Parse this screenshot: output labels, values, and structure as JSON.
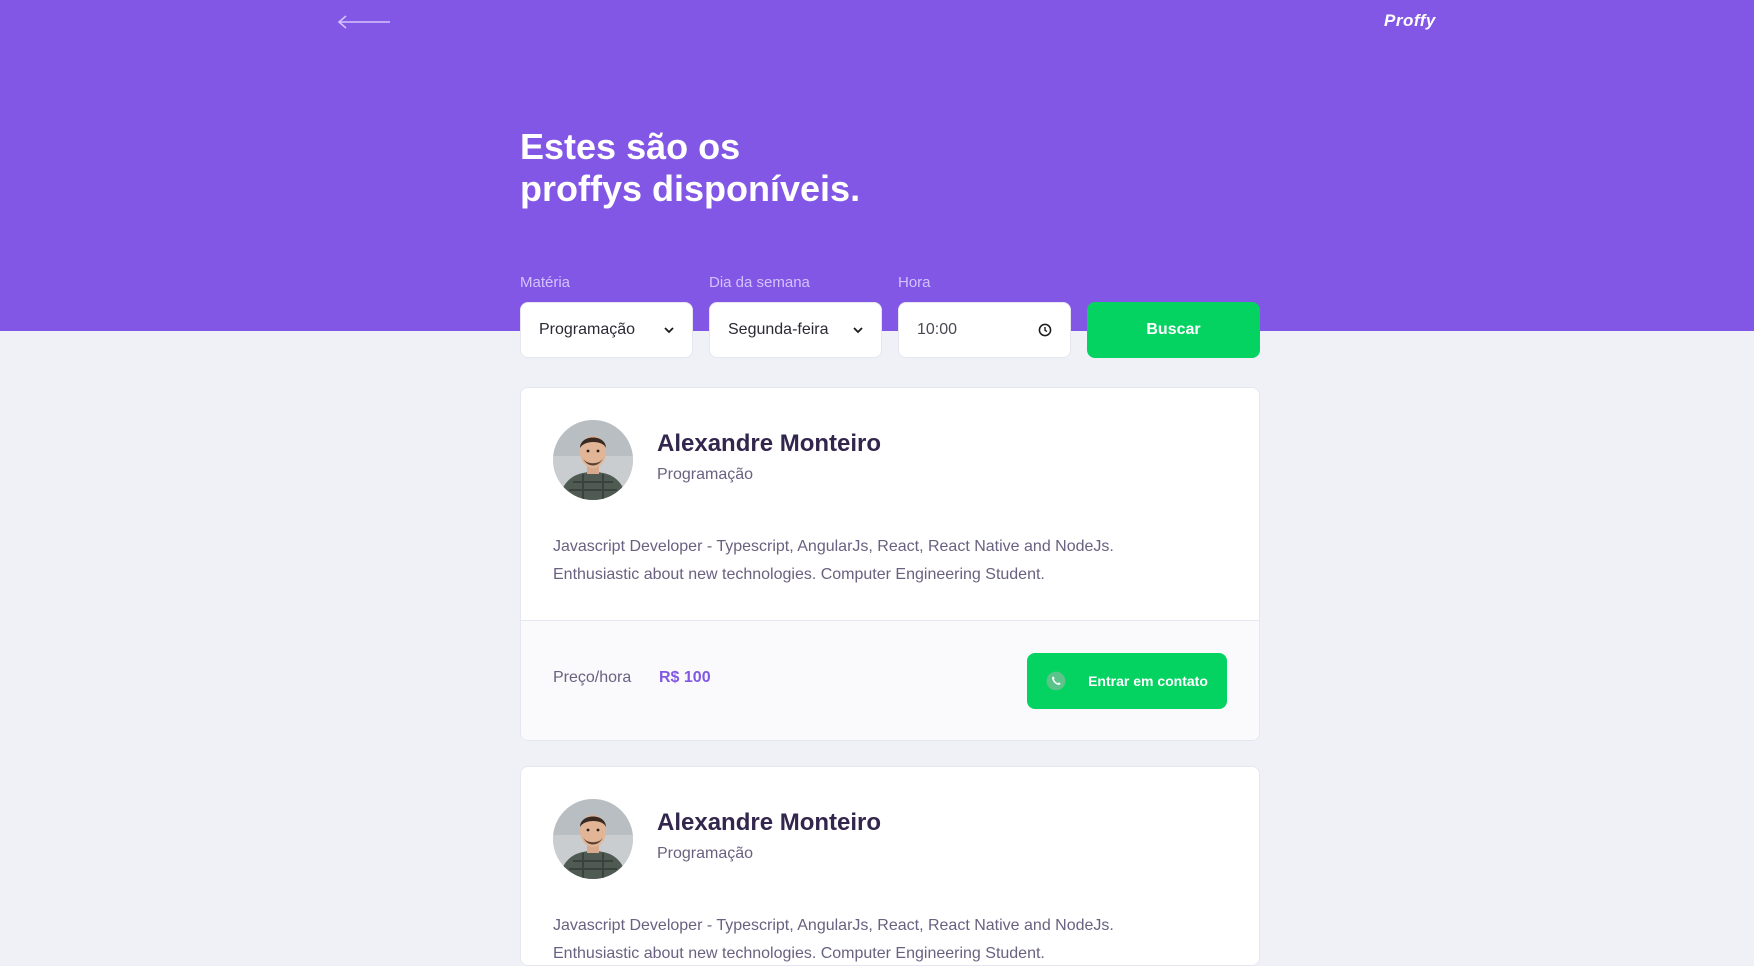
{
  "app": {
    "logo": "Proffy",
    "title_line1": "Estes são os",
    "title_line2": "proffys disponíveis."
  },
  "filters": {
    "subject_label": "Matéria",
    "subject_value": "Programação",
    "weekday_label": "Dia da semana",
    "weekday_value": "Segunda-feira",
    "time_label": "Hora",
    "time_value": "10:00",
    "search_label": "Buscar"
  },
  "teachers": [
    {
      "name": "Alexandre Monteiro",
      "subject": "Programação",
      "bio_line1": "Javascript Developer - Typescript, AngularJs, React, React Native and NodeJs.",
      "bio_line2": "Enthusiastic about new technologies. Computer Engineering Student.",
      "price_label": "Preço/hora",
      "price_value": "R$ 100",
      "contact_label": "Entrar em contato"
    },
    {
      "name": "Alexandre Monteiro",
      "subject": "Programação",
      "bio_line1": "Javascript Developer - Typescript, AngularJs, React, React Native and NodeJs.",
      "bio_line2": "Enthusiastic about new technologies. Computer Engineering Student."
    }
  ],
  "colors": {
    "primary": "#8257E5",
    "secondary": "#04D361",
    "background": "#F0F0F7",
    "title_text": "#32264D",
    "body_text": "#6A6180"
  },
  "icons": {
    "back": "arrow-left-icon",
    "dropdown": "chevron-down-icon",
    "clock": "clock-icon",
    "contact": "whatsapp-icon"
  }
}
